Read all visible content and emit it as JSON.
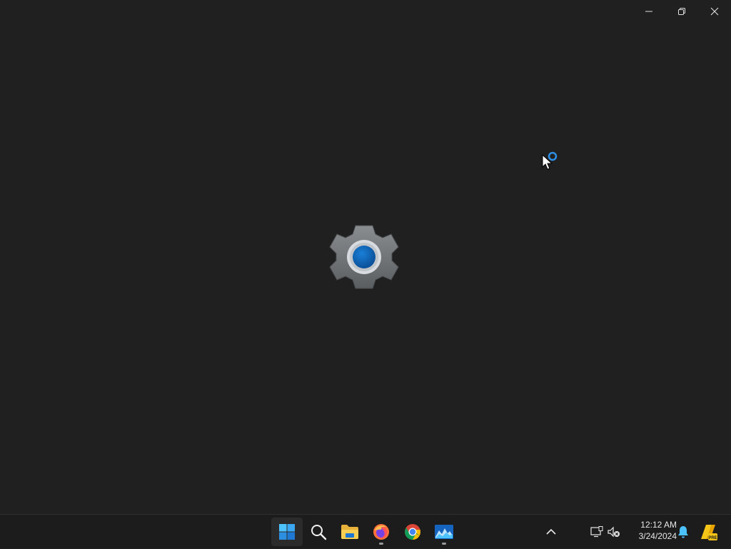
{
  "window": {
    "controls": {
      "minimize_icon": "minimize-icon",
      "restore_icon": "restore-icon",
      "close_icon": "close-icon"
    },
    "splash_icon": "settings-gear-icon"
  },
  "taskbar": {
    "pinned": [
      {
        "name": "Start",
        "icon": "windows-start-icon"
      },
      {
        "name": "Search",
        "icon": "search-icon"
      },
      {
        "name": "File Explorer",
        "icon": "folder-icon"
      },
      {
        "name": "Firefox",
        "icon": "firefox-icon",
        "running": true
      },
      {
        "name": "Chrome",
        "icon": "chrome-icon"
      },
      {
        "name": "Settings",
        "icon": "settings-app-icon",
        "running": true
      }
    ],
    "tray": {
      "clock_time": "12:12 AM",
      "clock_date": "3/24/2024"
    }
  },
  "colors": {
    "background": "#202020",
    "accent": "#0f6cbd",
    "taskbar": "#1c1c1c"
  }
}
